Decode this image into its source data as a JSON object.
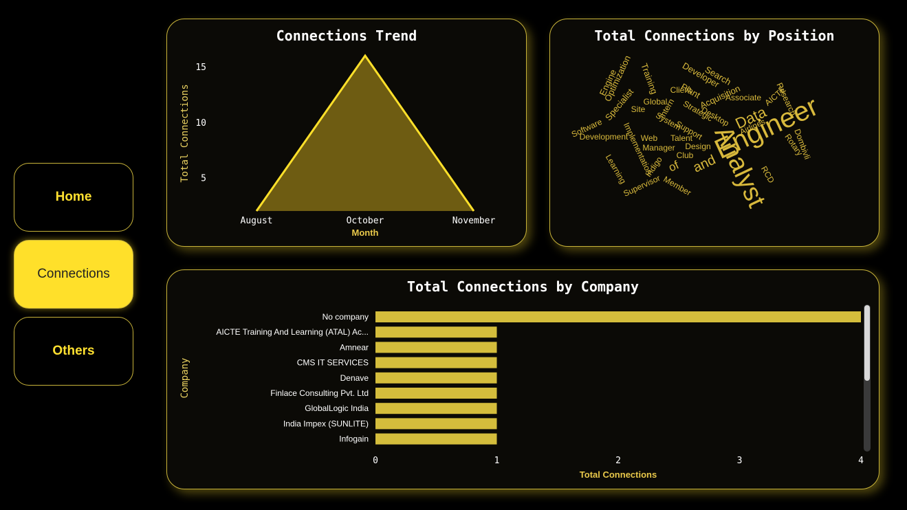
{
  "nav": {
    "items": [
      {
        "label": "Home",
        "active": false
      },
      {
        "label": "Connections",
        "active": true
      },
      {
        "label": "Others",
        "active": false
      }
    ]
  },
  "colors": {
    "accent": "#ffe02a",
    "bar": "#d4bd3c",
    "area_fill": "#6e5c12",
    "area_line": "#ffe02a"
  },
  "chart_data": [
    {
      "type": "area",
      "title": "Connections Trend",
      "xlabel": "Month",
      "ylabel": "Total Connections",
      "categories": [
        "August",
        "October",
        "November"
      ],
      "values": [
        2,
        16,
        2
      ],
      "yticks": [
        5,
        10,
        15
      ],
      "ylim": [
        2,
        16
      ]
    },
    {
      "type": "wordcloud",
      "title": "Total Connections by Position",
      "words": [
        "Engineer",
        "Analyst",
        "Data",
        "and",
        "of",
        "Training",
        "Optimization",
        "Engine",
        "Specialist",
        "Developer",
        "Search",
        "Plant",
        "Acquisition",
        "AICTE",
        "Research",
        "Client",
        "Global",
        "Associate",
        "Intern",
        "Strategic",
        "Desktop",
        "Airlines",
        "Site",
        "Software",
        "System",
        "Support",
        "Development",
        "Implementation",
        "Web",
        "Talent",
        "Dombivli",
        "Rotary",
        "Manager",
        "Design",
        "Indigo",
        "Club",
        "Learning",
        "Member",
        "RCD",
        "Supervisor"
      ]
    },
    {
      "type": "bar",
      "orientation": "horizontal",
      "title": "Total Connections by Company",
      "xlabel": "Total Connections",
      "ylabel": "Company",
      "categories": [
        "No company",
        "AICTE Training And Learning (ATAL) Ac...",
        "Amnear",
        "CMS IT SERVICES",
        "Denave",
        "Finlace Consulting Pvt. Ltd",
        "GlobalLogic India",
        "India Impex (SUNLITE)",
        "Infogain"
      ],
      "values": [
        4,
        1,
        1,
        1,
        1,
        1,
        1,
        1,
        1
      ],
      "xticks": [
        0,
        1,
        2,
        3,
        4
      ],
      "xlim": [
        0,
        4
      ]
    }
  ]
}
